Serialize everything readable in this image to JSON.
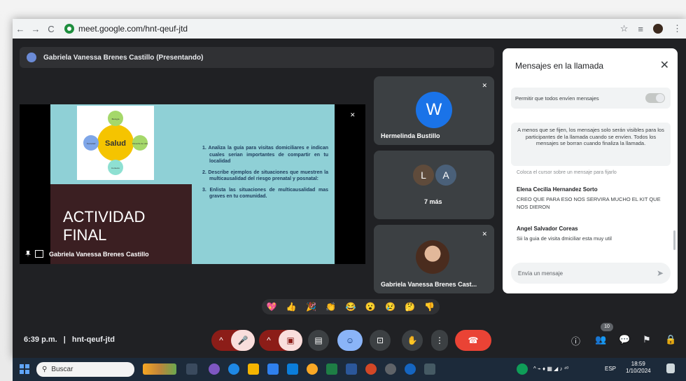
{
  "browser": {
    "url": "meet.google.com/hnt-qeuf-jtd",
    "back_icon": "←",
    "forward_icon": "→",
    "reload_icon": "C",
    "star_icon": "☆",
    "ext_icon": "≡",
    "menu_icon": "⋮"
  },
  "meet": {
    "presenter_banner": "Gabriela Vanessa Brenes Castillo (Presentando)",
    "slide": {
      "center_word": "Salud",
      "node_labels": [
        "Biología",
        "Filosofía de vida",
        "Contexto",
        "Sociedad"
      ],
      "title_line1": "ACTIVIDAD",
      "title_line2": "FINAL",
      "items": [
        "1. Analiza la guía para visitas domiciliares e indican cuales serian importantes de compartir en tu localidad",
        "2. Describe ejemplos de situaciones que muestren la multicausalidad del riesgo prenatal y posnatal:",
        "3. Enlista las situaciones de multicausalidad mas graves en tu comunidad."
      ]
    },
    "presenter_name": "Gabriela Vanessa Brenes Castillo",
    "tiles": [
      {
        "name": "Hermelinda Bustillo",
        "initial": "W"
      },
      {
        "name": "7 más",
        "initials": [
          "L",
          "A"
        ]
      },
      {
        "name": "Gabriela Vanessa Brenes Cast..."
      }
    ],
    "mic_off_icon": "✕"
  },
  "chat": {
    "title": "Mensajes en la llamada",
    "close": "✕",
    "allow_label": "Permitir que todos envíen mensajes",
    "notice": "A menos que se fijen, los mensajes solo serán visibles para los participantes de la llamada cuando se envíen. Todos los mensajes se borran cuando finaliza la llamada.",
    "cut_text": "Coloca el cursor sobre un mensaje para fijarlo",
    "messages": [
      {
        "sender": "Elena Cecilia Hernandez Sorto",
        "text": "CREO QUE PARA ESO NOS SERVIRA MUCHO EL KIT QUE NOS DIERON"
      },
      {
        "sender": "Angel Salvador Coreas",
        "text": "Sii la guia de visita dmiciliar esta muy util"
      }
    ],
    "input_placeholder": "Envía un mensaje",
    "send_icon": "➤"
  },
  "reactions": [
    "💖",
    "👍",
    "🎉",
    "👏",
    "😂",
    "😮",
    "😢",
    "🤔",
    "👎"
  ],
  "controls": {
    "time": "6:39 p.m.",
    "separator": "|",
    "meeting_code": "hnt-qeuf-jtd",
    "mic_icon": "🎤",
    "cam_icon": "▣",
    "caption_icon": "▤",
    "emoji_icon": "☺",
    "present_icon": "⊡",
    "hand_icon": "✋",
    "more_icon": "⋮",
    "hangup_icon": "☎",
    "chevron": "^",
    "info_icon": "ⓘ",
    "people_icon": "👥",
    "people_count": "10",
    "chat_icon": "💬",
    "activities_icon": "⚑",
    "lock_icon": "🔒"
  },
  "taskbar": {
    "search": "Buscar",
    "lang": "ESP",
    "time": "18:59",
    "date": "1/10/2024",
    "tray_icons": "^  ⌁  ♦  ▦  ◢  ♪  ⁴⁰"
  }
}
